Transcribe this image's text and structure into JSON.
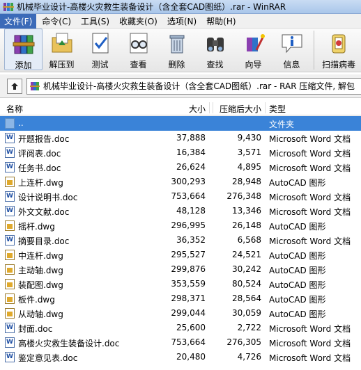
{
  "window": {
    "title": "机械毕业设计-高楼火灾救生装备设计（含全套CAD图纸）.rar - WinRAR"
  },
  "menubar": {
    "items": [
      {
        "label": "文件(F)",
        "active": true
      },
      {
        "label": "命令(C)"
      },
      {
        "label": "工具(S)"
      },
      {
        "label": "收藏夹(O)"
      },
      {
        "label": "选项(N)"
      },
      {
        "label": "帮助(H)"
      }
    ]
  },
  "toolbar": {
    "add": "添加",
    "extract": "解压到",
    "test": "测试",
    "view": "查看",
    "delete": "删除",
    "find": "查找",
    "wizard": "向导",
    "info": "信息",
    "virus": "扫描病毒"
  },
  "address": {
    "text": "机械毕业设计-高楼火灾救生装备设计（含全套CAD图纸）.rar - RAR 压缩文件, 解包"
  },
  "columns": {
    "name": "名称",
    "size": "大小",
    "packed": "压缩后大小",
    "type": "类型"
  },
  "files": [
    {
      "name": "..",
      "size": "",
      "packed": "",
      "type": "文件夹",
      "kind": "folder"
    },
    {
      "name": "开题报告.doc",
      "size": "37,888",
      "packed": "9,430",
      "type": "Microsoft Word 文档",
      "kind": "doc"
    },
    {
      "name": "评阅表.doc",
      "size": "16,384",
      "packed": "3,571",
      "type": "Microsoft Word 文档",
      "kind": "doc"
    },
    {
      "name": "任务书.doc",
      "size": "26,624",
      "packed": "4,895",
      "type": "Microsoft Word 文档",
      "kind": "doc"
    },
    {
      "name": "上连杆.dwg",
      "size": "300,293",
      "packed": "28,948",
      "type": "AutoCAD 图形",
      "kind": "dwg"
    },
    {
      "name": "设计说明书.doc",
      "size": "753,664",
      "packed": "276,348",
      "type": "Microsoft Word 文档",
      "kind": "doc"
    },
    {
      "name": "外文文献.doc",
      "size": "48,128",
      "packed": "13,346",
      "type": "Microsoft Word 文档",
      "kind": "doc"
    },
    {
      "name": "摇杆.dwg",
      "size": "296,995",
      "packed": "26,148",
      "type": "AutoCAD 图形",
      "kind": "dwg"
    },
    {
      "name": "摘要目录.doc",
      "size": "36,352",
      "packed": "6,568",
      "type": "Microsoft Word 文档",
      "kind": "doc"
    },
    {
      "name": "中连杆.dwg",
      "size": "295,527",
      "packed": "24,521",
      "type": "AutoCAD 图形",
      "kind": "dwg"
    },
    {
      "name": "主动轴.dwg",
      "size": "299,876",
      "packed": "30,242",
      "type": "AutoCAD 图形",
      "kind": "dwg"
    },
    {
      "name": "装配图.dwg",
      "size": "353,559",
      "packed": "80,524",
      "type": "AutoCAD 图形",
      "kind": "dwg"
    },
    {
      "name": "板件.dwg",
      "size": "298,371",
      "packed": "28,564",
      "type": "AutoCAD 图形",
      "kind": "dwg"
    },
    {
      "name": "从动轴.dwg",
      "size": "299,044",
      "packed": "30,059",
      "type": "AutoCAD 图形",
      "kind": "dwg"
    },
    {
      "name": "封面.doc",
      "size": "25,600",
      "packed": "2,722",
      "type": "Microsoft Word 文档",
      "kind": "doc"
    },
    {
      "name": "高楼火灾救生装备设计.doc",
      "size": "753,664",
      "packed": "276,305",
      "type": "Microsoft Word 文档",
      "kind": "doc"
    },
    {
      "name": "鉴定意见表.doc",
      "size": "20,480",
      "packed": "4,726",
      "type": "Microsoft Word 文档",
      "kind": "doc"
    }
  ]
}
